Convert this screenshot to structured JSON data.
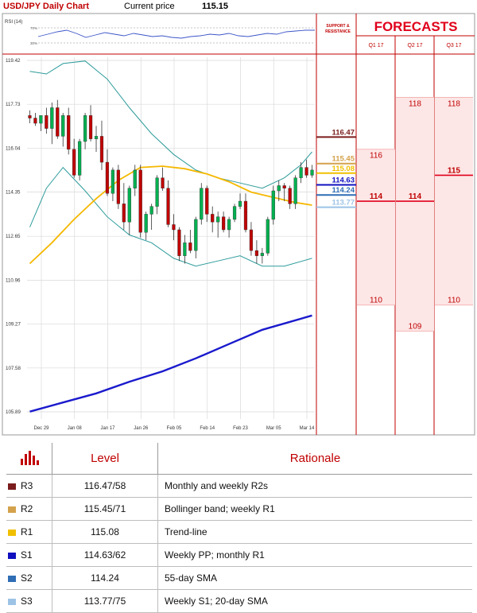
{
  "header": {
    "title": "USD/JPY Daily Chart",
    "price_label": "Current price",
    "price_value": "115.15"
  },
  "panel": {
    "sr_heading": "SUPPORT & RESISTANCE",
    "forecasts_title": "FORECASTS",
    "quarters": [
      "Q1 17",
      "Q2 17",
      "Q3 17"
    ]
  },
  "chart_data": {
    "type": "candlestick",
    "rsi": {
      "label": "RSI (14)",
      "levels": [
        "70%",
        "30%"
      ]
    },
    "y_ticks": [
      "119.42",
      "117.73",
      "116.04",
      "114.35",
      "112.65",
      "110.96",
      "109.27",
      "107.58",
      "105.89"
    ],
    "ylim": [
      105.89,
      119.42
    ],
    "x_ticks": [
      "Dec 29",
      "Jan 08",
      "Jan 17",
      "Jan 26",
      "Feb 05",
      "Feb 14",
      "Feb 23",
      "Mar 05",
      "Mar 14"
    ],
    "candles": [
      [
        117.3,
        117.5,
        117.0,
        117.2
      ],
      [
        117.2,
        117.4,
        116.9,
        117.0
      ],
      [
        117.0,
        117.3,
        116.7,
        117.3
      ],
      [
        117.3,
        117.6,
        116.6,
        116.8
      ],
      [
        116.8,
        117.8,
        116.2,
        117.6
      ],
      [
        117.6,
        117.9,
        116.4,
        116.5
      ],
      [
        116.5,
        117.4,
        116.1,
        117.3
      ],
      [
        117.3,
        117.6,
        115.8,
        116.0
      ],
      [
        116.0,
        116.4,
        114.9,
        115.0
      ],
      [
        115.0,
        116.4,
        114.8,
        116.3
      ],
      [
        116.3,
        117.4,
        116.0,
        117.3
      ],
      [
        117.3,
        117.7,
        116.3,
        116.4
      ],
      [
        116.4,
        116.9,
        115.9,
        116.5
      ],
      [
        116.5,
        117.1,
        115.2,
        115.5
      ],
      [
        115.5,
        116.0,
        114.2,
        114.3
      ],
      [
        114.3,
        115.3,
        114.0,
        115.2
      ],
      [
        115.2,
        115.4,
        113.7,
        113.9
      ],
      [
        113.9,
        114.7,
        112.9,
        113.2
      ],
      [
        113.2,
        114.6,
        112.7,
        114.5
      ],
      [
        114.5,
        115.4,
        114.2,
        115.2
      ],
      [
        115.2,
        115.4,
        112.6,
        112.8
      ],
      [
        112.8,
        113.6,
        112.5,
        113.5
      ],
      [
        113.5,
        113.9,
        112.9,
        113.8
      ],
      [
        113.8,
        115.0,
        113.5,
        114.9
      ],
      [
        114.9,
        115.3,
        114.4,
        114.5
      ],
      [
        114.5,
        114.8,
        113.0,
        113.1
      ],
      [
        113.1,
        113.5,
        112.5,
        112.9
      ],
      [
        112.9,
        113.0,
        111.7,
        111.9
      ],
      [
        111.9,
        112.7,
        111.6,
        112.4
      ],
      [
        112.4,
        112.9,
        112.0,
        112.1
      ],
      [
        112.1,
        113.4,
        111.8,
        113.3
      ],
      [
        113.3,
        114.7,
        113.1,
        114.5
      ],
      [
        114.5,
        114.6,
        113.2,
        113.5
      ],
      [
        113.5,
        113.8,
        112.8,
        113.2
      ],
      [
        113.2,
        113.6,
        112.6,
        113.4
      ],
      [
        113.4,
        113.6,
        112.8,
        112.9
      ],
      [
        112.9,
        113.4,
        112.6,
        113.3
      ],
      [
        113.3,
        113.9,
        113.2,
        113.8
      ],
      [
        113.8,
        114.3,
        113.7,
        114.0
      ],
      [
        114.0,
        114.3,
        112.8,
        112.9
      ],
      [
        112.9,
        113.2,
        111.9,
        112.1
      ],
      [
        112.1,
        112.5,
        111.6,
        111.9
      ],
      [
        111.9,
        112.2,
        111.6,
        112.0
      ],
      [
        112.0,
        113.4,
        111.9,
        113.3
      ],
      [
        113.3,
        114.6,
        113.1,
        114.4
      ],
      [
        114.4,
        114.8,
        114.0,
        114.6
      ],
      [
        114.6,
        114.7,
        114.0,
        114.5
      ],
      [
        114.5,
        114.6,
        113.7,
        113.9
      ],
      [
        113.9,
        115.0,
        113.7,
        114.9
      ],
      [
        114.9,
        115.5,
        114.7,
        115.3
      ],
      [
        115.3,
        115.6,
        114.9,
        115.0
      ],
      [
        115.0,
        115.4,
        114.9,
        115.2
      ]
    ],
    "sma_200": [
      [
        0,
        105.9
      ],
      [
        6,
        106.25
      ],
      [
        12,
        106.6
      ],
      [
        18,
        107.05
      ],
      [
        24,
        107.45
      ],
      [
        30,
        107.95
      ],
      [
        36,
        108.5
      ],
      [
        42,
        109.05
      ],
      [
        51,
        109.6
      ]
    ],
    "sma_55": [
      [
        0,
        111.6
      ],
      [
        4,
        112.4
      ],
      [
        8,
        113.3
      ],
      [
        12,
        114.1
      ],
      [
        16,
        114.8
      ],
      [
        20,
        115.3
      ],
      [
        24,
        115.35
      ],
      [
        28,
        115.25
      ],
      [
        32,
        115.05
      ],
      [
        36,
        114.75
      ],
      [
        40,
        114.35
      ],
      [
        44,
        114.15
      ],
      [
        48,
        113.95
      ],
      [
        51,
        113.85
      ]
    ],
    "bollinger_upper": [
      [
        0,
        119.0
      ],
      [
        3,
        118.9
      ],
      [
        6,
        119.3
      ],
      [
        10,
        119.4
      ],
      [
        14,
        118.7
      ],
      [
        18,
        117.6
      ],
      [
        22,
        116.6
      ],
      [
        26,
        115.8
      ],
      [
        30,
        115.2
      ],
      [
        34,
        114.9
      ],
      [
        38,
        114.7
      ],
      [
        42,
        114.5
      ],
      [
        46,
        114.9
      ],
      [
        49,
        115.4
      ],
      [
        51,
        115.9
      ]
    ],
    "bollinger_lower": [
      [
        0,
        113.0
      ],
      [
        3,
        114.5
      ],
      [
        6,
        115.3
      ],
      [
        10,
        114.4
      ],
      [
        14,
        113.4
      ],
      [
        18,
        112.7
      ],
      [
        22,
        112.4
      ],
      [
        26,
        111.8
      ],
      [
        30,
        111.5
      ],
      [
        34,
        111.7
      ],
      [
        38,
        111.9
      ],
      [
        42,
        111.5
      ],
      [
        46,
        111.5
      ],
      [
        51,
        111.8
      ]
    ],
    "levels": [
      {
        "name": "R3",
        "value": 116.47,
        "label": "116.47",
        "color": "#7b1c1c"
      },
      {
        "name": "R2",
        "value": 115.45,
        "label": "115.45",
        "color": "#d4a24c"
      },
      {
        "name": "R1",
        "value": 115.08,
        "label": "115.08",
        "color": "#f0c000"
      },
      {
        "name": "S1",
        "value": 114.63,
        "label": "114.63",
        "color": "#1010c0"
      },
      {
        "name": "S2",
        "value": 114.24,
        "label": "114.24",
        "color": "#2f6db5"
      },
      {
        "name": "S3",
        "value": 113.77,
        "label": "113.77",
        "color": "#9cc3e6"
      }
    ],
    "forecasts": [
      {
        "quarter": "Q1 17",
        "high": 116,
        "mid": 114,
        "low": 110
      },
      {
        "quarter": "Q2 17",
        "high": 118,
        "mid": 114,
        "low": 109
      },
      {
        "quarter": "Q3 17",
        "high": 118,
        "mid": 115,
        "low": 110
      }
    ],
    "forecast_labels": {
      "q1": {
        "high": "116",
        "mid": "114",
        "low": "110"
      },
      "q2": {
        "high": "118",
        "mid": "114",
        "low": "109"
      },
      "q3": {
        "high": "118",
        "mid": "115",
        "low": "110"
      }
    },
    "colors": {
      "up": "#00b050",
      "down": "#c00000",
      "sma200": "#1a1acd",
      "sma55": "#f5b800",
      "boll": "#2e9b9b",
      "fc_fill": "#fde6e6",
      "fc_line": "#e0001b"
    }
  },
  "table": {
    "header": {
      "level": "Level",
      "rationale": "Rationale"
    },
    "rows": [
      {
        "name": "R3",
        "level": "116.47/58",
        "rationale": "Monthly and weekly R2s",
        "color": "#7b1c1c"
      },
      {
        "name": "R2",
        "level": "115.45/71",
        "rationale": "Bollinger band; weekly R1",
        "color": "#d4a24c"
      },
      {
        "name": "R1",
        "level": "115.08",
        "rationale": "Trend-line",
        "color": "#f0c000"
      },
      {
        "name": "S1",
        "level": "114.63/62",
        "rationale": "Weekly PP; monthly R1",
        "color": "#1010c0"
      },
      {
        "name": "S2",
        "level": "114.24",
        "rationale": "55-day SMA",
        "color": "#2f6db5"
      },
      {
        "name": "S3",
        "level": "113.77/75",
        "rationale": "Weekly S1; 20-day SMA",
        "color": "#9cc3e6"
      }
    ]
  }
}
